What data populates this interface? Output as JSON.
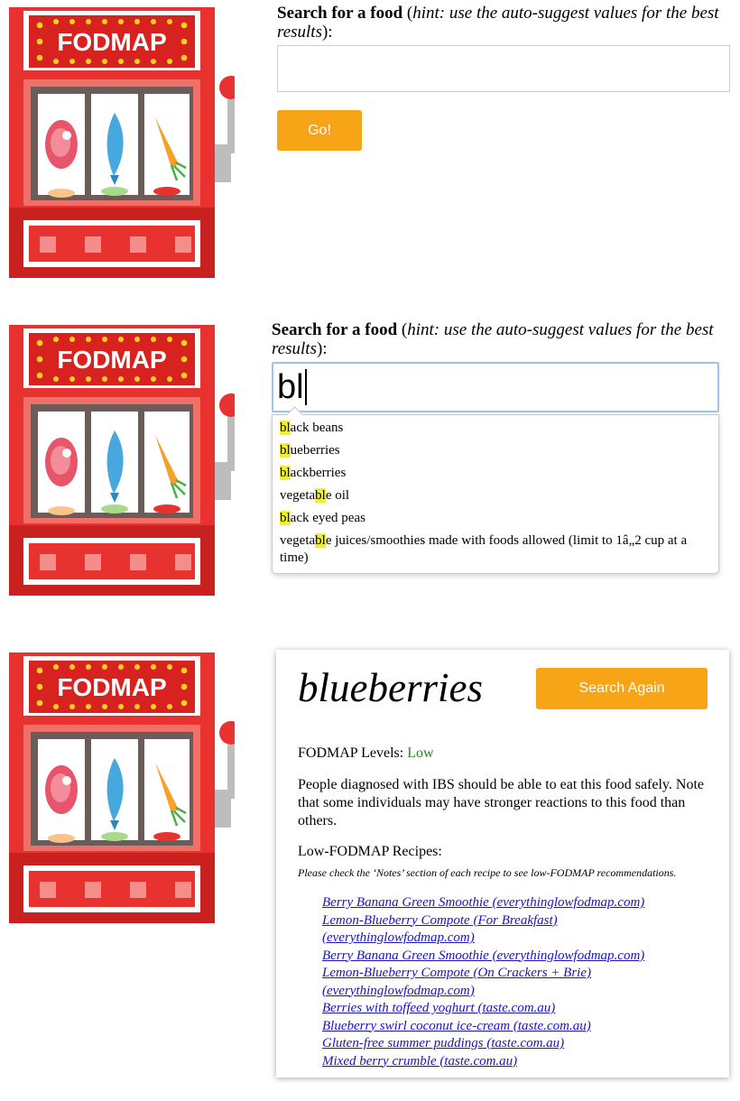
{
  "logo": {
    "text": "FODMAP"
  },
  "search": {
    "label_bold": "Search for a food",
    "label_hint": "hint: use the auto-suggest values for the best results",
    "label_open": " (",
    "label_close": "):",
    "go_label": "Go!",
    "typed_value": "bl"
  },
  "suggestions": [
    {
      "before": "",
      "match": "bl",
      "after": "ack beans"
    },
    {
      "before": "",
      "match": "bl",
      "after": "ueberries"
    },
    {
      "before": "",
      "match": "bl",
      "after": "ackberries"
    },
    {
      "before": "vegeta",
      "match": "bl",
      "after": "e oil"
    },
    {
      "before": "",
      "match": "bl",
      "after": "ack eyed peas"
    },
    {
      "before": "vegeta",
      "match": "bl",
      "after": "e juices/smoothies made with foods allowed (limit to 1â„2 cup at a time)"
    }
  ],
  "result": {
    "food_name": "blueberries",
    "search_again_label": "Search Again",
    "levels_label": "FODMAP Levels: ",
    "levels_value": "Low",
    "description": "People diagnosed with IBS should be able to eat this food safely. Note that some individuals may have stronger reactions to this food than others.",
    "recipes_heading": "Low-FODMAP Recipes:",
    "recipes_note": "Please check the ‘Notes’ section of each recipe to see low-FODMAP recommendations.",
    "recipes": [
      "Berry Banana Green Smoothie (everythinglowfodmap.com)",
      "Lemon-Blueberry Compote (For Breakfast) (everythinglowfodmap.com)",
      "Berry Banana Green Smoothie (everythinglowfodmap.com)",
      "Lemon-Blueberry Compote (On Crackers + Brie) (everythinglowfodmap.com)",
      "Berries with toffeed yoghurt (taste.com.au)",
      "Blueberry swirl coconut ice-cream (taste.com.au)",
      "Gluten-free summer puddings (taste.com.au)",
      "Mixed berry crumble (taste.com.au)"
    ]
  },
  "colors": {
    "accent": "#f7a416",
    "machine_red": "#e8322f",
    "low": "#1f8a1f",
    "link": "#1a12c4",
    "highlight": "#f0f030"
  }
}
